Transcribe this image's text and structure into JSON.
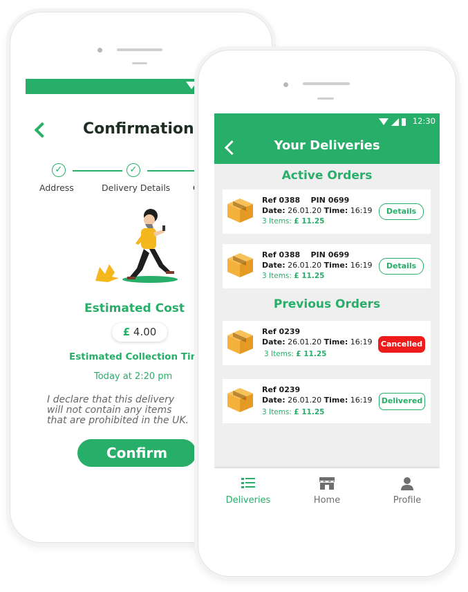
{
  "confirmation_screen": {
    "title": "Confirmation",
    "steps": [
      "Address",
      "Delivery Details",
      "C"
    ],
    "estimated_cost_label": "Estimated Cost",
    "currency_symbol": "£",
    "cost_value": "4.00",
    "estimated_collection_label": "Estimated Collection Tim",
    "collection_time": "Today at 2:20 pm",
    "declaration_lines": [
      "I declare that this delivery",
      "will not contain any items",
      "that are prohibited in the UK."
    ],
    "confirm_button": "Confirm"
  },
  "deliveries_screen": {
    "status_time": "12:30",
    "title": "Your Deliveries",
    "active_heading": "Active Orders",
    "previous_heading": "Previous Orders",
    "active_orders": [
      {
        "ref": "Ref 0388",
        "pin": "PIN 0699",
        "date_label": "Date:",
        "date": "26.01.20",
        "time_label": "Time:",
        "time": "16:19",
        "items": "3 Items:",
        "price": "£ 11.25",
        "action": "Details"
      },
      {
        "ref": "Ref 0388",
        "pin": "PIN 0699",
        "date_label": "Date:",
        "date": "26.01.20",
        "time_label": "Time:",
        "time": "16:19",
        "items": "3 Items:",
        "price": "£ 11.25",
        "action": "Details"
      }
    ],
    "previous_orders": [
      {
        "ref": "Ref 0239",
        "date_label": "Date:",
        "date": "26.01.20",
        "time_label": "Time:",
        "time": "16:19",
        "items": "3 Items:",
        "price": "£ 11.25",
        "status": "Cancelled"
      },
      {
        "ref": "Ref 0239",
        "date_label": "Date:",
        "date": "26.01.20",
        "time_label": "Time:",
        "time": "16:19",
        "items": "3 Items:",
        "price": "£ 11.25",
        "status": "Delivered"
      }
    ],
    "nav": [
      {
        "label": "Deliveries",
        "icon": "list-icon",
        "active": true
      },
      {
        "label": "Home",
        "icon": "store-icon",
        "active": false
      },
      {
        "label": "Profile",
        "icon": "person-icon",
        "active": false
      }
    ]
  },
  "colors": {
    "brand_green": "#27ae68",
    "cancel_red": "#ee1b1b",
    "box_orange": "#f4b23c"
  }
}
